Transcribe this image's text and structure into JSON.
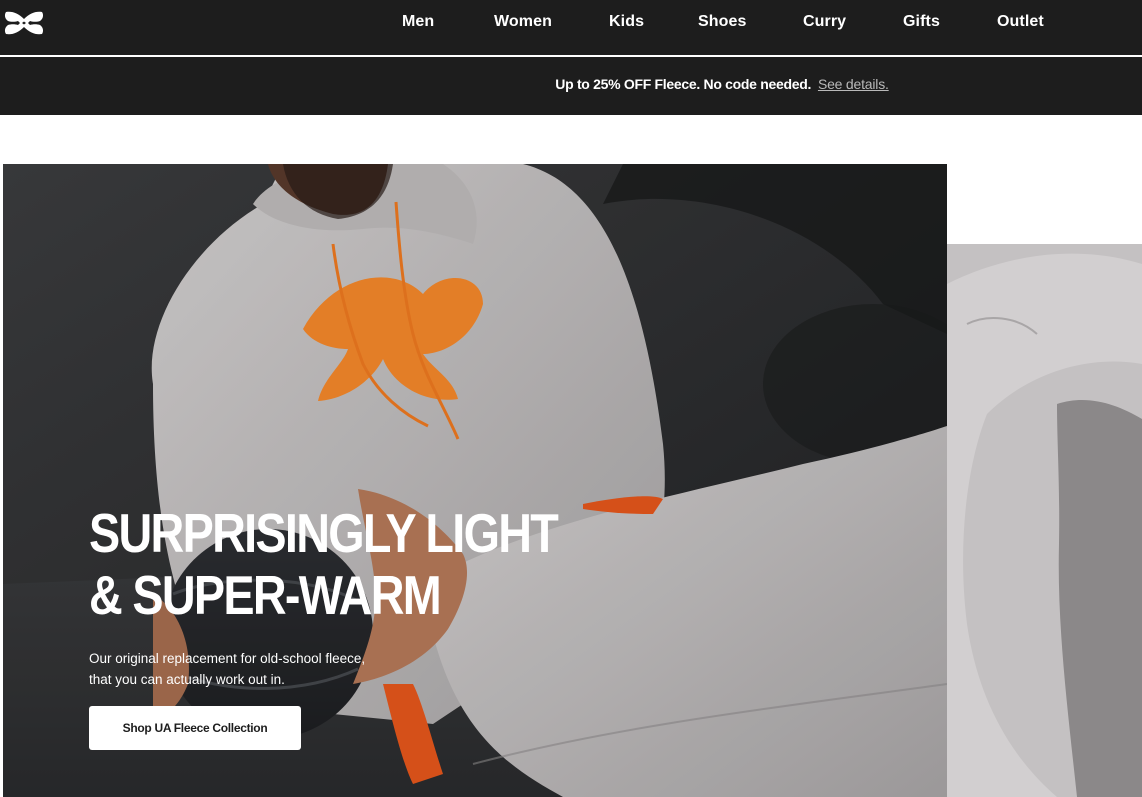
{
  "brand": {
    "logo": "ua-logo-icon"
  },
  "nav": {
    "items": [
      {
        "label": "Men"
      },
      {
        "label": "Women"
      },
      {
        "label": "Kids"
      },
      {
        "label": "Shoes"
      },
      {
        "label": "Curry"
      },
      {
        "label": "Gifts"
      },
      {
        "label": "Outlet"
      }
    ]
  },
  "promo": {
    "text": "Up to 25% OFF Fleece. No code needed.",
    "link_label": "See details."
  },
  "hero": {
    "title_line1": "SURPRISINGLY LIGHT",
    "title_line2": "& SUPER-WARM",
    "subtitle_line1": "Our original replacement for old-school fleece,",
    "subtitle_line2": "that you can actually work out in.",
    "cta_label": "Shop UA Fleece Collection"
  },
  "colors": {
    "nav_bg": "#1d1d1d",
    "accent_orange": "#f7892b",
    "fleece_gray": "#c9c6c6"
  }
}
